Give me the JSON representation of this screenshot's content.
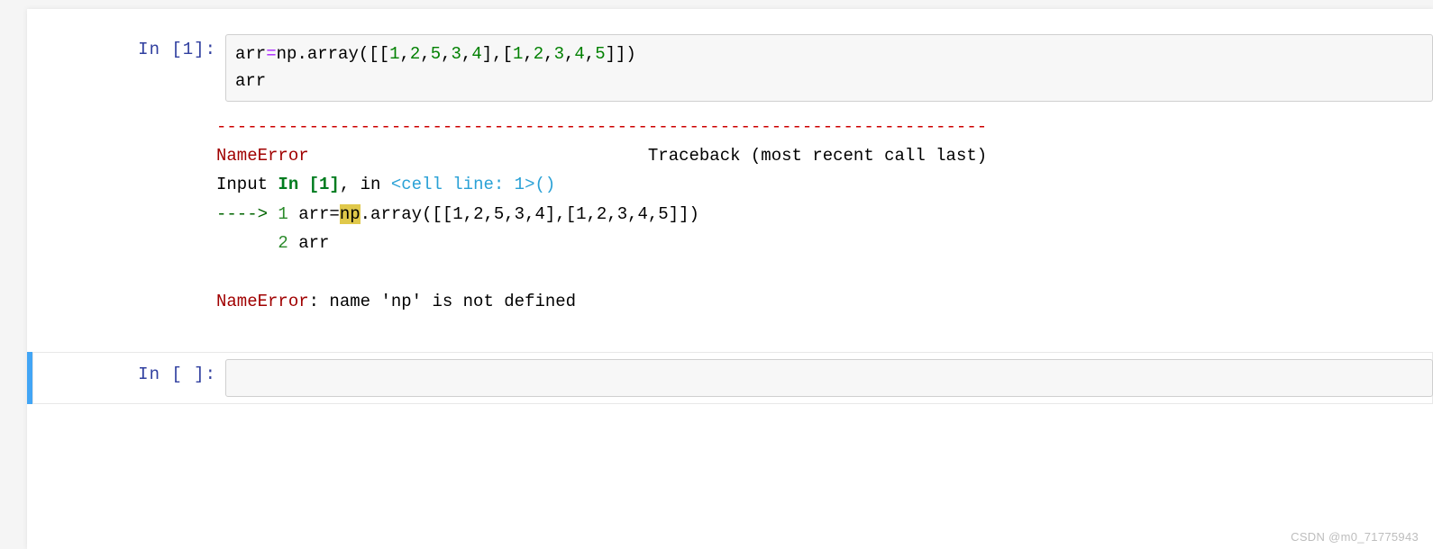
{
  "cells": {
    "c1": {
      "prompt": "In  [1]:",
      "code": {
        "line1": {
          "var": "arr",
          "eq": "=",
          "obj": "np",
          "dot": ".",
          "fn": "array",
          "open": "([[",
          "n1": "1",
          "c1": ",",
          "n2": "2",
          "c2": ",",
          "n3": "5",
          "c3": ",",
          "n4": "3",
          "c4": ",",
          "n5": "4",
          "mid": "],[",
          "m1": "1",
          "d1": ",",
          "m2": "2",
          "d2": ",",
          "m3": "3",
          "d3": ",",
          "m4": "4",
          "d4": ",",
          "m5": "5",
          "close": "]])"
        },
        "line2": "arr"
      }
    },
    "out1": {
      "sep": "---------------------------------------------------------------------------",
      "err_header_left": "NameError",
      "err_header_right": "Traceback (most recent call last)",
      "input_ref_a": "Input ",
      "input_ref_b": "In [1]",
      "input_ref_c": ", in ",
      "cell_line": "<cell line: 1>",
      "parens": "()",
      "arrow": "----> ",
      "ln1": "1",
      "code1a": " arr=",
      "code1_hl": "np",
      "code1b": ".array([[1,2,5,3,4],[1,2,3,4,5]])",
      "ln2": "2",
      "code2": " arr",
      "final_a": "NameError",
      "final_b": ": name 'np' is not defined"
    },
    "c2": {
      "prompt": "In  [ ]:"
    }
  },
  "watermark": "CSDN @m0_71775943"
}
